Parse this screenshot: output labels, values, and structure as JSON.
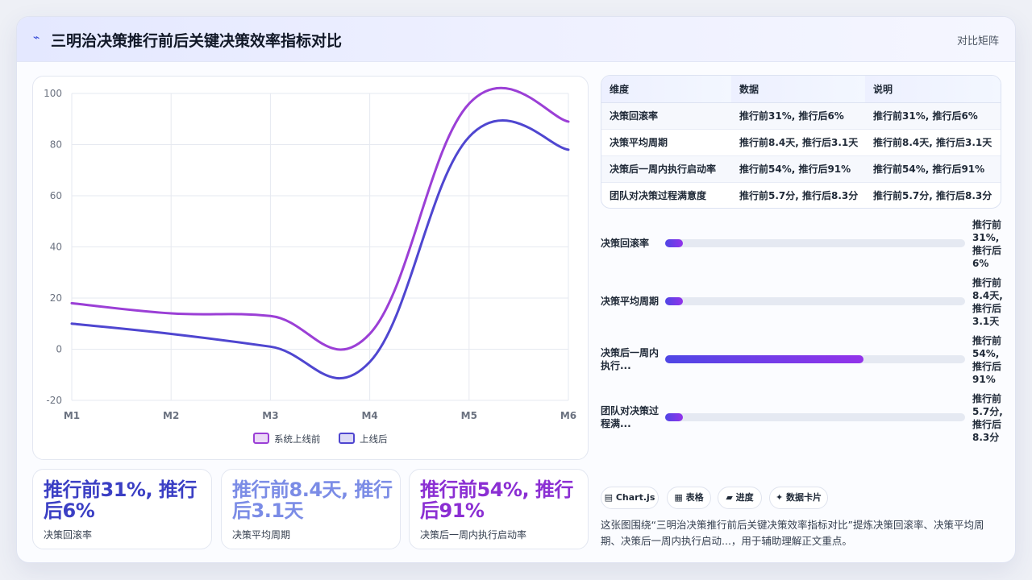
{
  "header": {
    "icon": "bolt-icon",
    "title": "三明治决策推行前后关键决策效率指标对比",
    "tag": "对比矩阵"
  },
  "chart_data": {
    "type": "line",
    "categories": [
      "M1",
      "M2",
      "M3",
      "M4",
      "M5",
      "M6"
    ],
    "series": [
      {
        "name": "系统上线前",
        "values": [
          18,
          14,
          13,
          6,
          96,
          89
        ],
        "color": "#9b3fd6"
      },
      {
        "name": "上线后",
        "values": [
          10,
          6,
          1,
          -5,
          83,
          78
        ],
        "color": "#4f46d0"
      }
    ],
    "ylim": [
      -20,
      100
    ],
    "yticks": [
      -20,
      0,
      20,
      40,
      60,
      80,
      100
    ],
    "grid": true,
    "legend": "bottom"
  },
  "table": {
    "headers": [
      "维度",
      "数据",
      "说明"
    ],
    "rows": [
      [
        "决策回滚率",
        "推行前31%, 推行后6%",
        "推行前31%, 推行后6%"
      ],
      [
        "决策平均周期",
        "推行前8.4天, 推行后3.1天",
        "推行前8.4天, 推行后3.1天"
      ],
      [
        "决策后一周内执行启动率",
        "推行前54%, 推行后91%",
        "推行前54%, 推行后91%"
      ],
      [
        "团队对决策过程满意度",
        "推行前5.7分, 推行后8.3分",
        "推行前5.7分, 推行后8.3分"
      ]
    ]
  },
  "bars": [
    {
      "label_l1": "决策回滚率",
      "label_l2": "",
      "value_lines": [
        "推行前",
        "31%,",
        "推行后",
        "6%"
      ],
      "fill": 0.06
    },
    {
      "label_l1": "决策平均周期",
      "label_l2": "",
      "value_lines": [
        "推行前",
        "8.4天,",
        "推行后",
        "3.1天"
      ],
      "fill": 0.06
    },
    {
      "label_l1": "决策后一周内",
      "label_l2": "执行...",
      "value_lines": [
        "推行前",
        "54%,",
        "推行后",
        "91%"
      ],
      "fill": 0.66
    },
    {
      "label_l1": "团队对决策过",
      "label_l2": "程满...",
      "value_lines": [
        "推行前",
        "5.7分,",
        "推行后",
        "8.3分"
      ],
      "fill": 0.06
    }
  ],
  "stats": [
    {
      "value": "推行前31%, 推行后6%",
      "label": "决策回滚率",
      "color": "#3b3fc4"
    },
    {
      "value": "推行前8.4天, 推行后3.1天",
      "label": "决策平均周期",
      "color": "#7b8ce6"
    },
    {
      "value": "推行前54%, 推行后91%",
      "label": "决策后一周内执行启动率",
      "color": "#8b2fd3"
    }
  ],
  "chips": [
    {
      "icon": "chart-icon",
      "glyph": "▤",
      "label": "Chart.js"
    },
    {
      "icon": "table-icon",
      "glyph": "▦",
      "label": "表格"
    },
    {
      "icon": "progress-icon",
      "glyph": "▰",
      "label": "进度"
    },
    {
      "icon": "sparkle-icon",
      "glyph": "✦",
      "label": "数据卡片"
    }
  ],
  "description": "这张图围绕“三明治决策推行前后关键决策效率指标对比”提炼决策回滚率、决策平均周期、决策后一周内执行启动...，用于辅助理解正文重点。"
}
